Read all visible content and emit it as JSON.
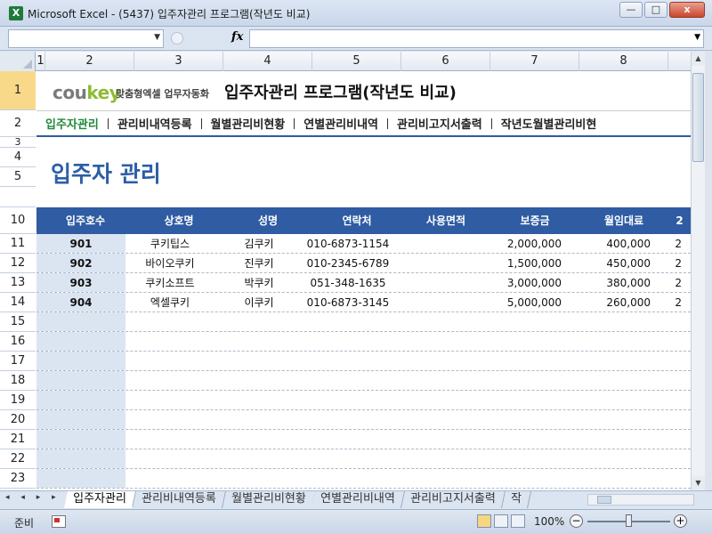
{
  "window": {
    "app_icon": "X",
    "title": "Microsoft Excel - (5437) 입주자관리 프로그램(작년도 비교)",
    "minimize": "—",
    "maximize": "□",
    "close": "x"
  },
  "formula_bar": {
    "name_box": "",
    "fx": "fx",
    "formula": ""
  },
  "columns": [
    "1",
    "2",
    "3",
    "4",
    "5",
    "6",
    "7",
    "8"
  ],
  "rows": [
    "1",
    "2",
    "3",
    "4",
    "5",
    "",
    "10",
    "11",
    "12",
    "13",
    "14",
    "15",
    "16",
    "17",
    "18",
    "19",
    "20",
    "21",
    "22",
    "23"
  ],
  "sheet": {
    "logo_cou": "cou",
    "logo_key": "key",
    "logo_sub": "맞춤형엑셀 업무자동화",
    "title": "입주자관리 프로그램(작년도 비교)",
    "nav": [
      "입주자관리",
      "관리비내역등록",
      "월별관리비현황",
      "연별관리비내역",
      "관리비고지서출력",
      "작년도월별관리비현"
    ],
    "section_title": "입주자 관리",
    "headers": [
      "입주호수",
      "상호명",
      "성명",
      "연락처",
      "사용면적",
      "보증금",
      "월임대료",
      "2"
    ],
    "data": [
      [
        "901",
        "쿠키팁스",
        "김쿠키",
        "010-6873-1154",
        "",
        "2,000,000",
        "400,000",
        "2"
      ],
      [
        "902",
        "바이오쿠키",
        "진쿠키",
        "010-2345-6789",
        "",
        "1,500,000",
        "450,000",
        "2"
      ],
      [
        "903",
        "쿠키소프트",
        "박쿠키",
        "051-348-1635",
        "",
        "3,000,000",
        "380,000",
        "2"
      ],
      [
        "904",
        "엑셀쿠키",
        "이쿠키",
        "010-6873-3145",
        "",
        "5,000,000",
        "260,000",
        "2"
      ]
    ],
    "accent_color": "#2f5ca3",
    "active_nav_color": "#1f8a3a"
  },
  "sheet_tabs": [
    "입주자관리",
    "관리비내역등록",
    "월별관리비현황",
    "연별관리비내역",
    "관리비고지서출력",
    "작"
  ],
  "tab_nav": "◂ ◂ ▸ ▸",
  "status": {
    "ready": "준비",
    "zoom": "100%",
    "zoom_minus": "−",
    "zoom_plus": "+"
  }
}
